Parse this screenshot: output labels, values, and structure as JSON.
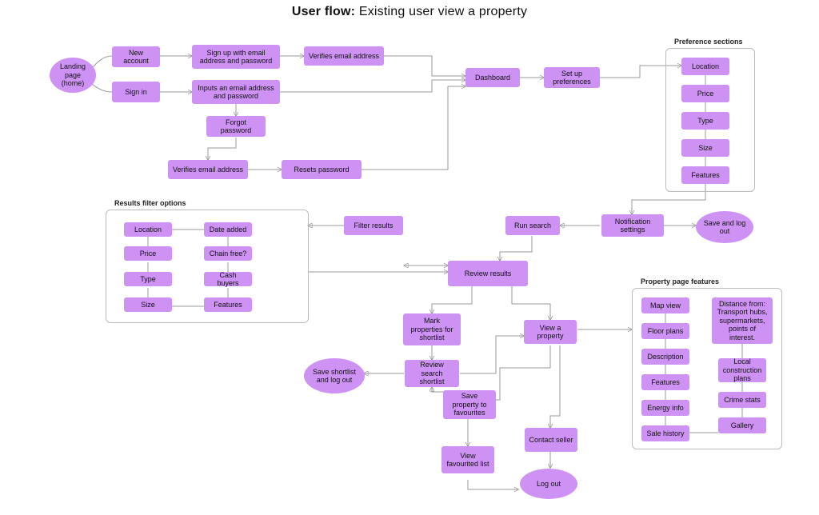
{
  "title": {
    "prefix": "User flow:",
    "text": " Existing user view a property"
  },
  "nodes": {
    "landing": "Landing page (home)",
    "new_account": "New account",
    "sign_in": "Sign in",
    "signup_email": "Sign up with email address and password",
    "inputs_creds": "Inputs an email address and password",
    "verifies_email": "Verifies email address",
    "forgot_password": "Forgot password",
    "resets_password": "Resets password",
    "dashboard": "Dashboard",
    "setup_prefs": "Set up preferences",
    "notification": "Notification settings",
    "save_logout": "Save and log out",
    "run_search": "Run search",
    "filter_results": "Filter results",
    "review_results": "Review results",
    "mark_props": "Mark properties for shortlist",
    "view_prop": "View a property",
    "review_shortlist": "Review search shortlist",
    "save_shortlist_logout": "Save shortlist and log out",
    "save_fav": "Save property to favourites",
    "contact_seller": "Contact seller",
    "view_fav_list": "View favourited list",
    "log_out": "Log out"
  },
  "groups": {
    "prefs": "Preference sections",
    "filters": "Results filter options",
    "property": "Property page features"
  },
  "prefs": [
    "Location",
    "Price",
    "Type",
    "Size",
    "Features"
  ],
  "filters": {
    "col1": [
      "Location",
      "Price",
      "Type",
      "Size"
    ],
    "col2": [
      "Date added",
      "Chain free?",
      "Cash buyers",
      "Features"
    ]
  },
  "property": {
    "col1": [
      "Map view",
      "Floor plans",
      "Description",
      "Features",
      "Energy info",
      "Sale history"
    ],
    "col2": [
      "Distance from: Transport hubs, supermarkets, points of interest.",
      "Local construction plans",
      "Crime stats",
      "Gallery"
    ]
  }
}
